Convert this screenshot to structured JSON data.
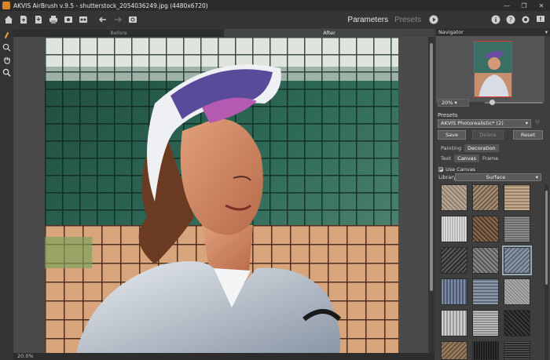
{
  "window": {
    "title": "AKVIS AirBrush v.9.5 - shutterstock_2054036249.jpg (4480x6720)",
    "controls": [
      "—",
      "❐",
      "✕"
    ]
  },
  "toolbar": {
    "mode_tabs": [
      "Parameters",
      "Presets"
    ],
    "active_mode": "Parameters"
  },
  "view": {
    "before_label": "Before",
    "after_label": "After",
    "active_view": "After",
    "zoom_status": "20.0%"
  },
  "navigator": {
    "title": "Navigator",
    "zoom_value": "20%",
    "zoom_slider_fraction": 0.12
  },
  "presets": {
    "label": "Presets",
    "selected": "AKVIS Photorealistic* (2)",
    "save_label": "Save",
    "delete_label": "Delete",
    "reset_label": "Reset"
  },
  "settings_tabs": [
    "Painting",
    "Decoration"
  ],
  "active_settings_tab": "Decoration",
  "decoration_tabs": [
    "Text",
    "Canvas",
    "Frame"
  ],
  "active_decoration_tab": "Canvas",
  "canvas": {
    "use_canvas_label": "Use Canvas",
    "use_canvas_checked": true,
    "library_label": "Library",
    "library_value": "Surface",
    "selected_texture_index": 8
  },
  "colors": {
    "accent_orange": "#d9862b",
    "panel_bg": "#3e3e3e",
    "canvas_bg": "#4a4a4a"
  }
}
